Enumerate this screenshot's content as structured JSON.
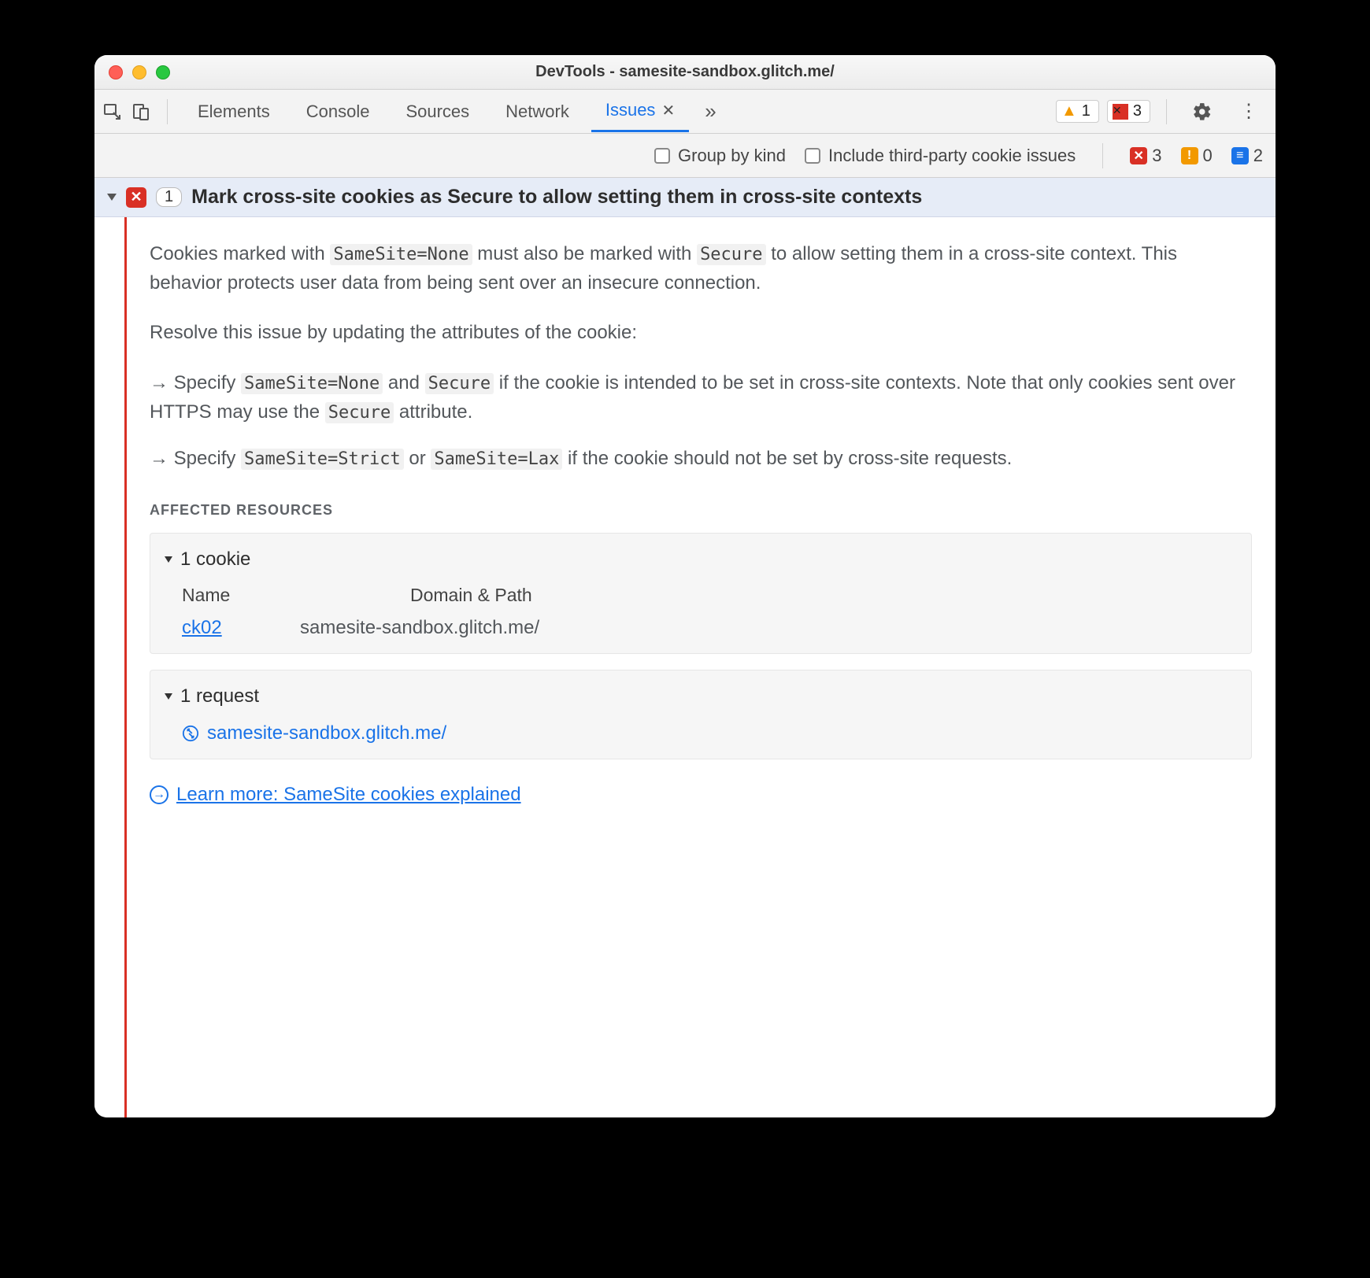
{
  "window": {
    "title": "DevTools - samesite-sandbox.glitch.me/"
  },
  "tabs": {
    "elements": "Elements",
    "console": "Console",
    "sources": "Sources",
    "network": "Network",
    "issues": "Issues"
  },
  "top_badges": {
    "warn": "1",
    "err": "3"
  },
  "filter": {
    "group_by_kind": "Group by kind",
    "include_third_party": "Include third-party cookie issues",
    "err_count": "3",
    "warn_count": "0",
    "info_count": "2"
  },
  "issue": {
    "count": "1",
    "title": "Mark cross-site cookies as Secure to allow setting them in cross-site contexts",
    "p1a": "Cookies marked with ",
    "p1code1": "SameSite=None",
    "p1b": " must also be marked with ",
    "p1code2": "Secure",
    "p1c": " to allow setting them in a cross-site context. This behavior protects user data from being sent over an insecure connection.",
    "p2": "Resolve this issue by updating the attributes of the cookie:",
    "b1a": "→ Specify ",
    "b1code1": "SameSite=None",
    "b1b": " and ",
    "b1code2": "Secure",
    "b1c": " if the cookie is intended to be set in cross-site contexts. Note that only cookies sent over HTTPS may use the ",
    "b1code3": "Secure",
    "b1d": " attribute.",
    "b2a": "→ Specify ",
    "b2code1": "SameSite=Strict",
    "b2b": " or ",
    "b2code2": "SameSite=Lax",
    "b2c": " if the cookie should not be set by cross-site requests.",
    "affected_label": "Affected Resources",
    "cookie_header": "1 cookie",
    "col_name": "Name",
    "col_domain": "Domain & Path",
    "cookie_name": "ck02",
    "cookie_domain": "samesite-sandbox.glitch.me/",
    "request_header": "1 request",
    "request_url": "samesite-sandbox.glitch.me/",
    "learn_more": "Learn more: SameSite cookies explained"
  }
}
